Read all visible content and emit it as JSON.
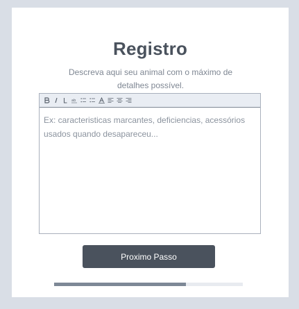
{
  "form": {
    "title": "Registro",
    "subtitle": "Descreva aqui seu animal com o máximo de detalhes possível.",
    "editor": {
      "placeholder": "Ex: caracteristicas marcantes, deficiencias, acessórios usados quando desapareceu...",
      "toolbar": [
        {
          "name": "bold-icon",
          "glyph": "B"
        },
        {
          "name": "italic-icon",
          "glyph": "I"
        },
        {
          "name": "link-icon",
          "glyph": "L"
        },
        {
          "name": "underline-icon",
          "glyph": "ab"
        },
        {
          "name": "ordered-list-icon",
          "glyph": "list-ol"
        },
        {
          "name": "bullet-list-icon",
          "glyph": "list-ul"
        },
        {
          "name": "font-color-icon",
          "glyph": "A"
        },
        {
          "name": "align-left-icon",
          "glyph": "align-left"
        },
        {
          "name": "align-center-icon",
          "glyph": "align-center"
        },
        {
          "name": "align-right-icon",
          "glyph": "align-right"
        }
      ]
    },
    "next_button_label": "Proximo Passo",
    "progress_fraction": 0.7
  },
  "colors": {
    "background": "#d9dee6",
    "card": "#ffffff",
    "title": "#4a525d",
    "button": "#4a525d",
    "progress_fill": "#7d8896",
    "progress_track": "#e8ebf0"
  }
}
